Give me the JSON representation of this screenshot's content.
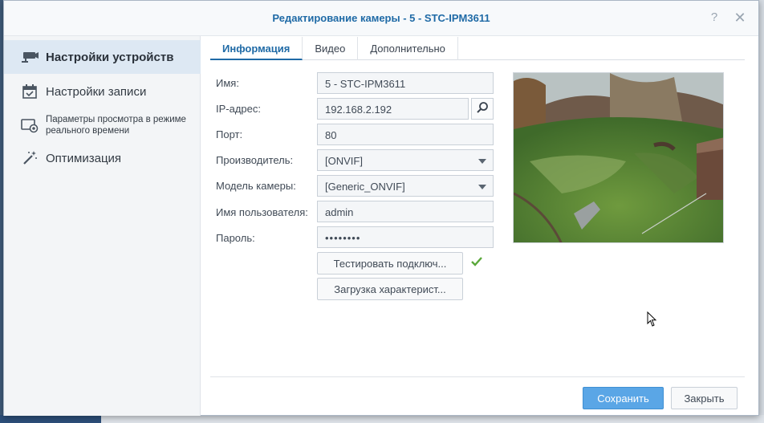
{
  "dialog": {
    "title": "Редактирование камеры - 5 - STC-IPM3611",
    "help_label": "?",
    "close_label": "✕"
  },
  "sidebar": {
    "items": [
      {
        "label": "Настройки устройств",
        "icon": "camera-icon",
        "active": true
      },
      {
        "label": "Настройки записи",
        "icon": "calendar-icon",
        "active": false
      },
      {
        "label": "Параметры просмотра в режиме реального времени",
        "icon": "live-view-icon",
        "active": false
      },
      {
        "label": "Оптимизация",
        "icon": "magic-wand-icon",
        "active": false
      }
    ]
  },
  "tabs": [
    {
      "label": "Информация",
      "active": true
    },
    {
      "label": "Видео",
      "active": false
    },
    {
      "label": "Дополнительно",
      "active": false
    }
  ],
  "form": {
    "name": {
      "label": "Имя:",
      "value": "5 - STC-IPM3611"
    },
    "ip": {
      "label": "IP-адрес:",
      "value": "192.168.2.192"
    },
    "port": {
      "label": "Порт:",
      "value": "80"
    },
    "vendor": {
      "label": "Производитель:",
      "value": "[ONVIF]"
    },
    "model": {
      "label": "Модель камеры:",
      "value": "[Generic_ONVIF]"
    },
    "username": {
      "label": "Имя пользователя:",
      "value": "admin"
    },
    "password": {
      "label": "Пароль:",
      "value": "••••••••"
    },
    "test_button": "Тестировать подключ...",
    "load_button": "Загрузка характерист..."
  },
  "footer": {
    "save_label": "Сохранить",
    "close_label": "Закрыть"
  },
  "colors": {
    "accent": "#1f6aa6",
    "primary_button": "#5aa6e6",
    "success": "#5aa83a"
  }
}
